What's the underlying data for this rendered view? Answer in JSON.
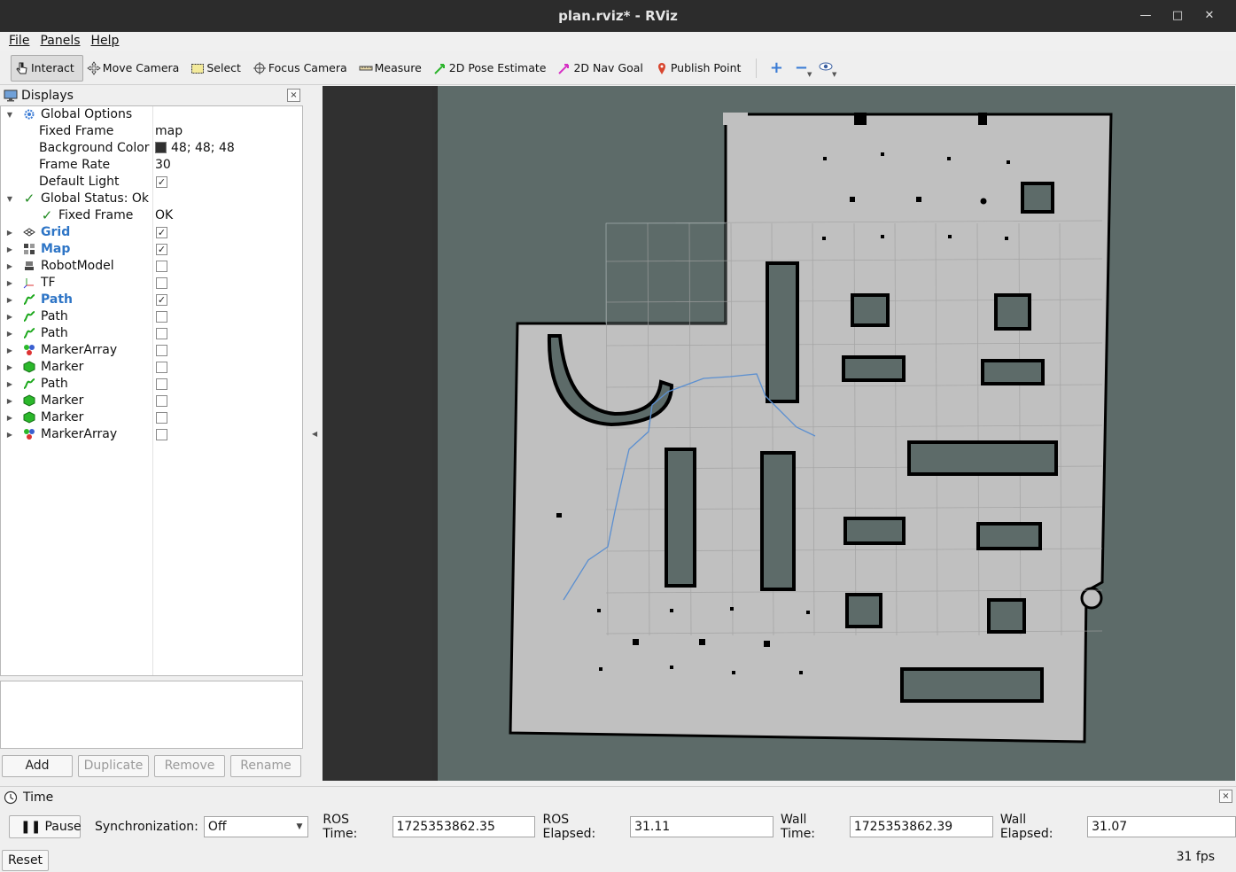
{
  "window": {
    "title": "plan.rviz* - RViz",
    "min": "—",
    "max": "□",
    "close": "✕"
  },
  "menu": {
    "file": "File",
    "panels": "Panels",
    "help": "Help"
  },
  "toolbar": {
    "interact": "Interact",
    "move_camera": "Move Camera",
    "select": "Select",
    "focus_camera": "Focus Camera",
    "measure": "Measure",
    "pose_estimate": "2D Pose Estimate",
    "nav_goal": "2D Nav Goal",
    "publish_point": "Publish Point"
  },
  "displays": {
    "title": "Displays",
    "close": "×",
    "global_options": "Global Options",
    "fixed_frame_label": "Fixed Frame",
    "fixed_frame_value": "map",
    "bg_color_label": "Background Color",
    "bg_color_value": "48; 48; 48",
    "bg_color_hex": "#303030",
    "frame_rate_label": "Frame Rate",
    "frame_rate_value": "30",
    "default_light_label": "Default Light",
    "global_status": "Global Status: Ok",
    "status_fixed_frame": "Fixed Frame",
    "status_fixed_frame_value": "OK",
    "items": [
      {
        "label": "Grid",
        "checked": true,
        "highlight": true,
        "icon": "grid-icon"
      },
      {
        "label": "Map",
        "checked": true,
        "highlight": true,
        "icon": "map-icon"
      },
      {
        "label": "RobotModel",
        "checked": false,
        "highlight": false,
        "icon": "robot-icon"
      },
      {
        "label": "TF",
        "checked": false,
        "highlight": false,
        "icon": "tf-axes-icon"
      },
      {
        "label": "Path",
        "checked": true,
        "highlight": true,
        "icon": "path-icon"
      },
      {
        "label": "Path",
        "checked": false,
        "highlight": false,
        "icon": "path-icon"
      },
      {
        "label": "Path",
        "checked": false,
        "highlight": false,
        "icon": "path-icon"
      },
      {
        "label": "MarkerArray",
        "checked": false,
        "highlight": false,
        "icon": "marker-array-icon"
      },
      {
        "label": "Marker",
        "checked": false,
        "highlight": false,
        "icon": "marker-icon"
      },
      {
        "label": "Path",
        "checked": false,
        "highlight": false,
        "icon": "path-icon"
      },
      {
        "label": "Marker",
        "checked": false,
        "highlight": false,
        "icon": "marker-icon"
      },
      {
        "label": "Marker",
        "checked": false,
        "highlight": false,
        "icon": "marker-icon"
      },
      {
        "label": "MarkerArray",
        "checked": false,
        "highlight": false,
        "icon": "marker-array-icon"
      }
    ],
    "buttons": {
      "add": "Add",
      "duplicate": "Duplicate",
      "remove": "Remove",
      "rename": "Rename"
    }
  },
  "time": {
    "title": "Time",
    "close": "×",
    "pause": "Pause",
    "sync_label": "Synchronization:",
    "sync_value": "Off",
    "ros_time_label": "ROS Time:",
    "ros_time": "1725353862.35",
    "ros_elapsed_label": "ROS Elapsed:",
    "ros_elapsed": "31.11",
    "wall_time_label": "Wall Time:",
    "wall_time": "1725353862.39",
    "wall_elapsed_label": "Wall Elapsed:",
    "wall_elapsed": "31.07",
    "reset": "Reset",
    "fps": "31 fps"
  },
  "colors": {
    "background": "#303030",
    "map_unknown": "#5d6b69",
    "map_free": "#c0c0c0",
    "map_occupied": "#000000",
    "path": "#5b8fd0",
    "grid": "#a0a0a0"
  }
}
